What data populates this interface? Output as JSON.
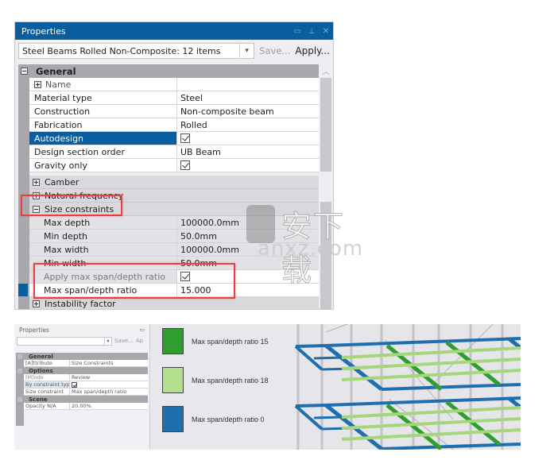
{
  "top_panel": {
    "title": "Properties",
    "title_buttons": [
      "restore-icon",
      "pin-icon",
      "close-icon"
    ],
    "selection_combo": "Steel Beams Rolled Non-Composite: 12 items",
    "save_label": "Save...",
    "apply_label": "Apply...",
    "categories": {
      "general": "General"
    },
    "name_group": "Name",
    "general_rows": [
      {
        "key": "Material type",
        "value": "Steel"
      },
      {
        "key": "Construction",
        "value": "Non-composite beam"
      },
      {
        "key": "Fabrication",
        "value": "Rolled"
      },
      {
        "key": "Autodesign",
        "value": "",
        "checkbox": true,
        "checked": true,
        "selected": true
      },
      {
        "key": "Design section order",
        "value": "UB Beam"
      },
      {
        "key": "Gravity only",
        "value": "",
        "checkbox": true,
        "checked": true
      }
    ],
    "groups": {
      "camber": "Camber",
      "natural_frequency": "Natural frequency",
      "size_constraints": "Size constraints",
      "instability_factor": "Instability factor"
    },
    "size_rows": [
      {
        "key": "Max depth",
        "value": "100000.0mm"
      },
      {
        "key": "Min depth",
        "value": "50.0mm"
      },
      {
        "key": "Max width",
        "value": "100000.0mm"
      },
      {
        "key": "Min width",
        "value": "50.0mm"
      },
      {
        "key": "Apply max span/depth ratio",
        "value": "",
        "checkbox": true,
        "checked": true
      },
      {
        "key": "Max span/depth ratio",
        "value": "15.000"
      }
    ]
  },
  "watermark": {
    "cn": "安下载",
    "en": "anxz.com"
  },
  "bottom_panel": {
    "title": "Properties",
    "save_label": "Save...",
    "apply_label": "Ap",
    "categories": [
      {
        "label": "General",
        "rows": [
          {
            "key": "[A]ttribute",
            "value": "Size Constraints"
          }
        ]
      },
      {
        "label": "Options",
        "rows": [
          {
            "key": "[M]ode",
            "value": "Review"
          },
          {
            "key": "By constraint type",
            "value": "",
            "checkbox": true
          },
          {
            "key": "Size constraint",
            "value": "Max span/depth ratio"
          }
        ]
      },
      {
        "label": "Scene",
        "rows": [
          {
            "key": "Opacity N/A",
            "value": "20.00%"
          }
        ]
      }
    ]
  },
  "legend": {
    "items": [
      {
        "label": "Max span/depth ratio 15",
        "color": "#2f9e2f"
      },
      {
        "label": "Max span/depth ratio 18",
        "color": "#b4e08e"
      },
      {
        "label": "Max span/depth ratio 0",
        "color": "#1f6fae"
      }
    ]
  },
  "colors": {
    "accent": "#0b5e9e",
    "highlight_box": "#e8403f",
    "beam_blue": "#1f6fae",
    "beam_green": "#2f9e2f",
    "beam_light_green": "#a6d67a"
  }
}
